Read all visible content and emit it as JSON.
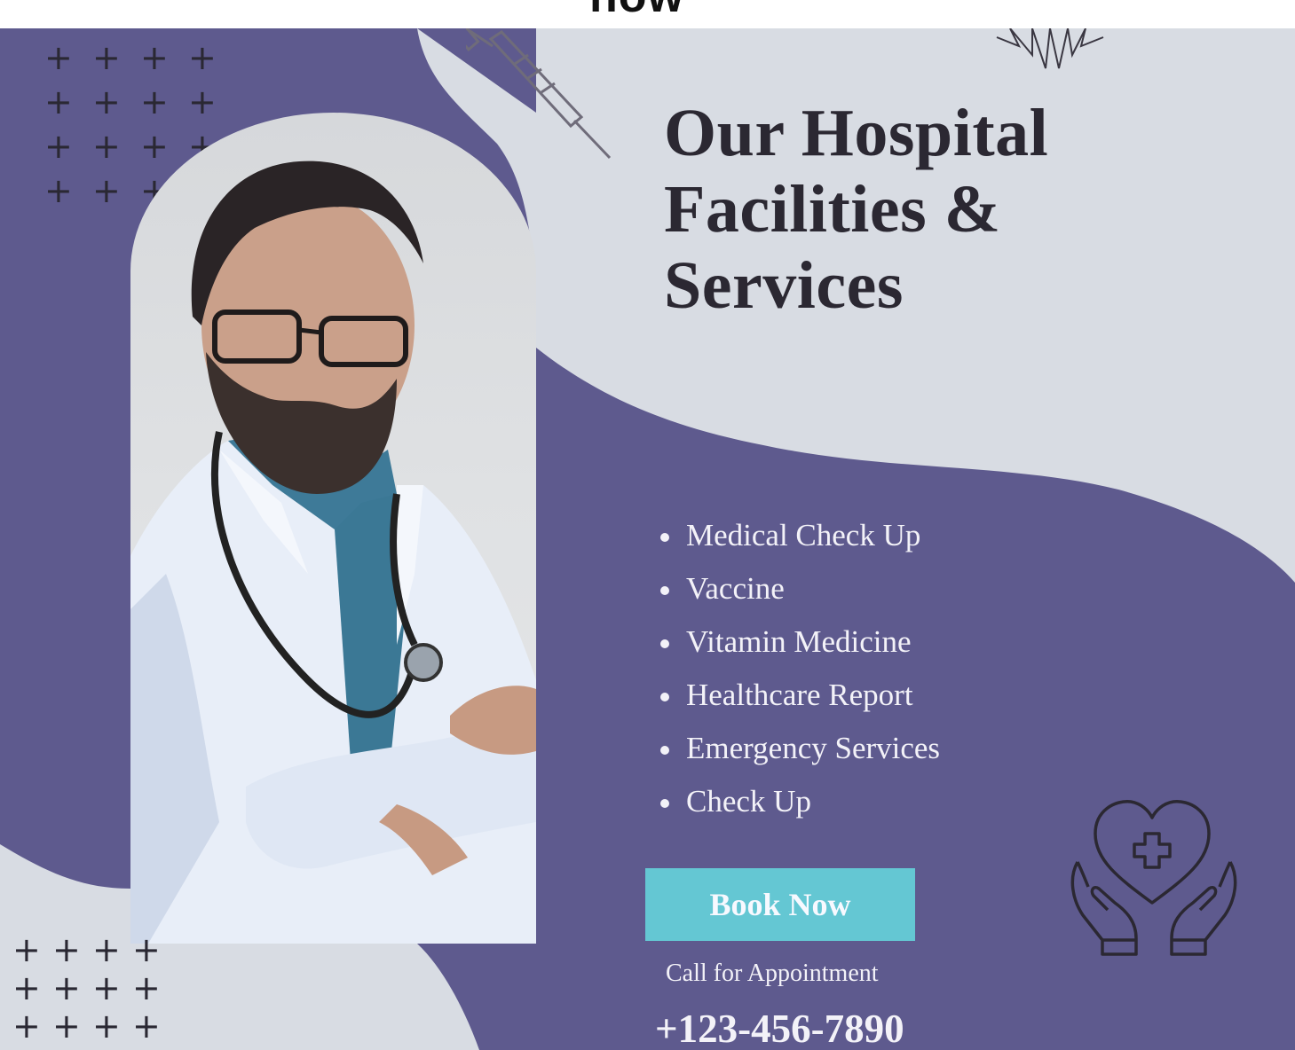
{
  "top_strip": {
    "cut_text": "now"
  },
  "title_lines": [
    "Our Hospital",
    "Facilities &",
    "Services"
  ],
  "services": [
    "Medical Check Up",
    "Vaccine",
    "Vitamin Medicine",
    "Healthcare Report",
    "Emergency Services",
    "Check Up"
  ],
  "cta": {
    "button_label": "Book Now",
    "call_label": "Call for Appointment",
    "phone": "+123-456-7890"
  },
  "colors": {
    "purple": "#5e5a8e",
    "light_gray": "#d8dce3",
    "teal_button": "#64c7d3",
    "dark_text": "#2b2832"
  },
  "icons": [
    "syringe-icon",
    "sunburst-icon",
    "heart-hands-icon",
    "plus-pattern"
  ]
}
